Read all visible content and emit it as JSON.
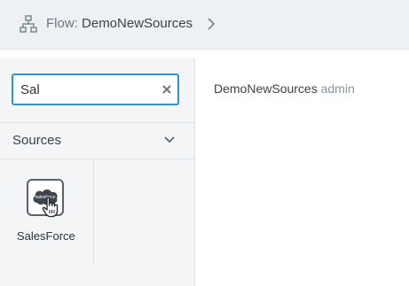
{
  "header": {
    "prefix": "Flow:",
    "flow_name": "DemoNewSources",
    "icon": "flow-icon"
  },
  "sidebar": {
    "search": {
      "value": "Sal",
      "placeholder": ""
    },
    "section": {
      "label": "Sources",
      "expanded": true
    },
    "sources": [
      {
        "label": "SalesForce",
        "logo_text": "salesforce",
        "icon": "salesforce-icon"
      }
    ]
  },
  "main": {
    "flow_name": "DemoNewSources",
    "owner": "admin"
  },
  "colors": {
    "accent": "#2e95d3",
    "header_bg": "#eef1f4",
    "panel_bg": "#f3f5f7"
  }
}
